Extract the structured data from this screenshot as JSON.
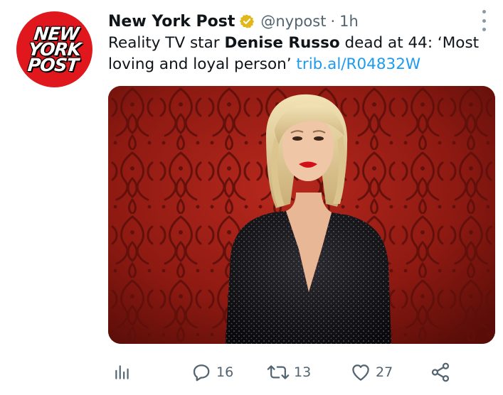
{
  "account": {
    "display_name": "New York Post",
    "handle": "@nypost",
    "separator": "·",
    "time": "1h",
    "logo_lines": [
      "NEW",
      "YORK",
      "POST"
    ]
  },
  "tweet": {
    "text_before": "Reality TV star ",
    "text_bold": "Denise Russo",
    "text_after": " dead at 44: ‘Most loving and loyal person’ ",
    "link": "trib.al/R04832W"
  },
  "media": {
    "description_icon": "photo-woman-black-sequin-dress-red-wallpaper"
  },
  "actions": {
    "analytics_icon": "bar-chart-icon",
    "reply_count": "16",
    "retweet_count": "13",
    "like_count": "27",
    "share_icon": "share-icon"
  },
  "colors": {
    "accent_link": "#1d9bf0",
    "verified_badge": "#e2b719",
    "avatar_bg": "#e0181d",
    "secondary_text": "#536471"
  }
}
